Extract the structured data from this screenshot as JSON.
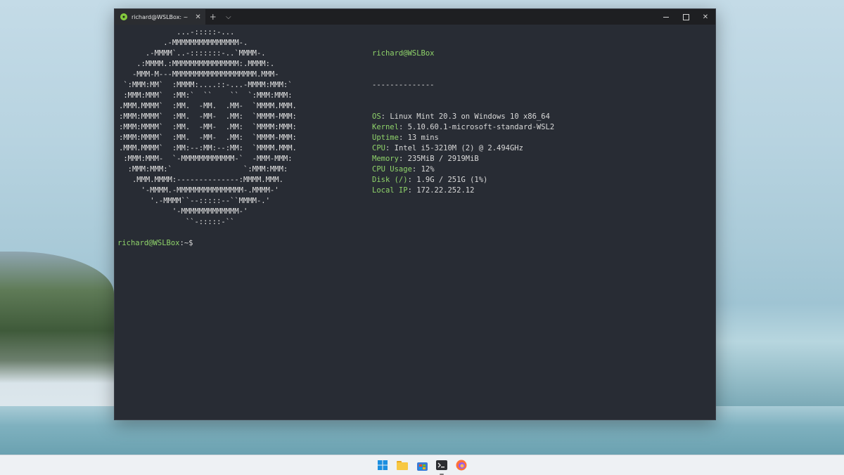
{
  "window": {
    "tab_title": "richard@WSLBox: ~",
    "new_tab": "+",
    "dropdown": "⌵",
    "tab_close": "✕",
    "close": "✕"
  },
  "ascii_logo": [
    "             ...-:::::-...",
    "          .-MMMMMMMMMMMMMMM-.",
    "      .-MMMM`..-:::::::-..`MMMM-.",
    "    .:MMMM.:MMMMMMMMMMMMMMM:.MMMM:.",
    "   -MMM-M---MMMMMMMMMMMMMMMMMMM.MMM-",
    " `:MMM:MM`  :MMMM:....::-...-MMMM:MMM:`",
    " :MMM:MMM`  :MM:`  ``    ``  `:MMM:MMM:",
    ".MMM.MMMM`  :MM.  -MM.  .MM-  `MMMM.MMM.",
    ":MMM:MMMM`  :MM.  -MM-  .MM:  `MMMM-MMM:",
    ":MMM:MMMM`  :MM.  -MM-  .MM:  `MMMM:MMM:",
    ":MMM:MMMM`  :MM.  -MM-  .MM:  `MMMM-MMM:",
    ".MMM.MMMM`  :MM:--:MM:--:MM:  `MMMM.MMM.",
    " :MMM:MMM-  `-MMMMMMMMMMMM-`  -MMM-MMM:",
    "  :MMM:MMM:`                `:MMM:MMM:",
    "   .MMM.MMMM:--------------:MMMM.MMM.",
    "     '-MMMM.-MMMMMMMMMMMMMMM-.MMMM-'",
    "       '.-MMMM``--:::::--``MMMM-.'",
    "            '-MMMMMMMMMMMMM-'",
    "               ``-:::::-``"
  ],
  "info": {
    "user_host": "richard@WSLBox",
    "separator": "--------------",
    "rows": [
      {
        "key": "OS",
        "value": "Linux Mint 20.3 on Windows 10 x86_64"
      },
      {
        "key": "Kernel",
        "value": "5.10.60.1-microsoft-standard-WSL2"
      },
      {
        "key": "Uptime",
        "value": "13 mins"
      },
      {
        "key": "CPU",
        "value": "Intel i5-3210M (2) @ 2.494GHz"
      },
      {
        "key": "Memory",
        "value": "235MiB / 2919MiB"
      },
      {
        "key": "CPU Usage",
        "value": "12%"
      },
      {
        "key": "Disk (/)",
        "value": "1.9G / 251G (1%)"
      },
      {
        "key": "Local IP",
        "value": "172.22.252.12"
      }
    ]
  },
  "prompt": {
    "user_host": "richard@WSLBox",
    "path": ":~$"
  },
  "taskbar": {
    "icons": [
      "windows-start-icon",
      "file-explorer-icon",
      "microsoft-store-icon",
      "terminal-icon",
      "firefox-icon"
    ]
  }
}
